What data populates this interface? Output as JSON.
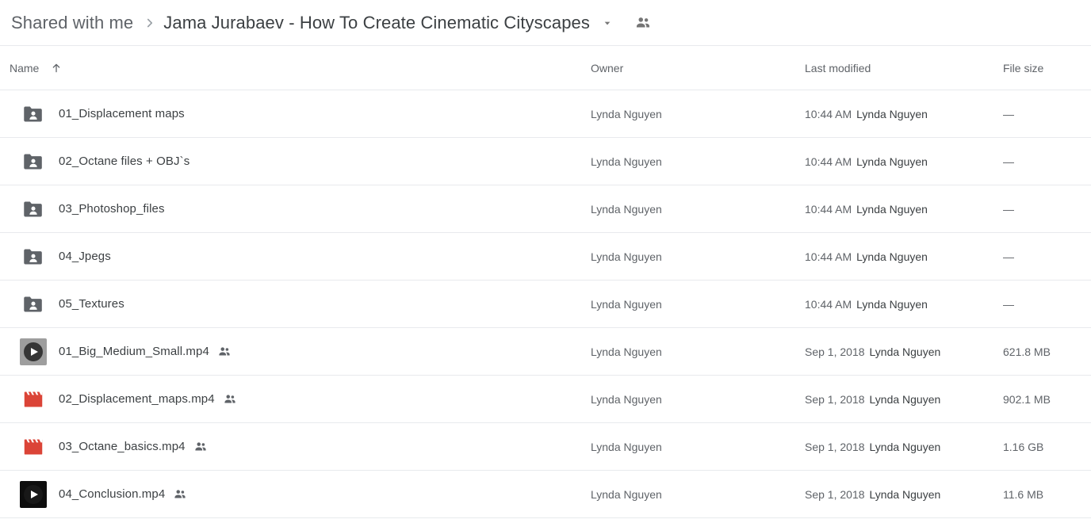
{
  "breadcrumb": {
    "root_label": "Shared with me",
    "separator": "chevron-right-icon",
    "current_label": "Jama Jurabaev - How To Create Cinematic Cityscapes",
    "caret_icon": "chevron-down-icon",
    "people_icon": "people-shared-icon"
  },
  "columns": {
    "name": "Name",
    "sort_icon": "arrow-up-icon",
    "owner": "Owner",
    "last_modified": "Last modified",
    "file_size": "File size"
  },
  "colors": {
    "text_primary": "#3c4043",
    "text_secondary": "#5f6368",
    "divider": "#e8eaed",
    "folder_icon": "#5f6368",
    "video_red": "#db4437",
    "thumb_gray": "#9e9e9e",
    "thumb_black": "#0d0d0d"
  },
  "rows": [
    {
      "icon": "shared-folder-icon",
      "icon_type": "folder",
      "name": "01_Displacement maps",
      "shared": false,
      "owner": "Lynda Nguyen",
      "modified_time": "10:44 AM",
      "modified_by": "Lynda Nguyen",
      "size": "—"
    },
    {
      "icon": "shared-folder-icon",
      "icon_type": "folder",
      "name": "02_Octane files + OBJ`s",
      "shared": false,
      "owner": "Lynda Nguyen",
      "modified_time": "10:44 AM",
      "modified_by": "Lynda Nguyen",
      "size": "—"
    },
    {
      "icon": "shared-folder-icon",
      "icon_type": "folder",
      "name": "03_Photoshop_files",
      "shared": false,
      "owner": "Lynda Nguyen",
      "modified_time": "10:44 AM",
      "modified_by": "Lynda Nguyen",
      "size": "—"
    },
    {
      "icon": "shared-folder-icon",
      "icon_type": "folder",
      "name": "04_Jpegs",
      "shared": false,
      "owner": "Lynda Nguyen",
      "modified_time": "10:44 AM",
      "modified_by": "Lynda Nguyen",
      "size": "—"
    },
    {
      "icon": "shared-folder-icon",
      "icon_type": "folder",
      "name": "05_Textures",
      "shared": false,
      "owner": "Lynda Nguyen",
      "modified_time": "10:44 AM",
      "modified_by": "Lynda Nguyen",
      "size": "—"
    },
    {
      "icon": "video-thumbnail-play-icon",
      "icon_type": "thumb_gray",
      "name": "01_Big_Medium_Small.mp4",
      "shared": true,
      "owner": "Lynda Nguyen",
      "modified_time": "Sep 1, 2018",
      "modified_by": "Lynda Nguyen",
      "size": "621.8 MB"
    },
    {
      "icon": "video-clapperboard-icon",
      "icon_type": "clapper",
      "name": "02_Displacement_maps.mp4",
      "shared": true,
      "owner": "Lynda Nguyen",
      "modified_time": "Sep 1, 2018",
      "modified_by": "Lynda Nguyen",
      "size": "902.1 MB"
    },
    {
      "icon": "video-clapperboard-icon",
      "icon_type": "clapper",
      "name": "03_Octane_basics.mp4",
      "shared": true,
      "owner": "Lynda Nguyen",
      "modified_time": "Sep 1, 2018",
      "modified_by": "Lynda Nguyen",
      "size": "1.16 GB"
    },
    {
      "icon": "video-thumbnail-play-icon",
      "icon_type": "thumb_black",
      "name": "04_Conclusion.mp4",
      "shared": true,
      "owner": "Lynda Nguyen",
      "modified_time": "Sep 1, 2018",
      "modified_by": "Lynda Nguyen",
      "size": "11.6 MB"
    }
  ]
}
